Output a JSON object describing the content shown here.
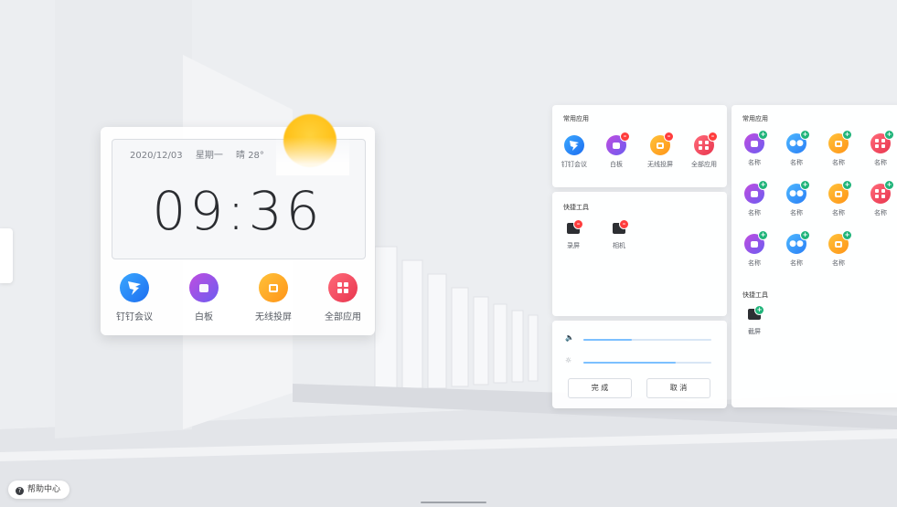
{
  "widget": {
    "date": "2020/12/03",
    "weekday": "星期一",
    "weather": "晴 28°",
    "time": "09:36",
    "apps": [
      {
        "label": "钉钉会议",
        "icon": "dingtalk-icon"
      },
      {
        "label": "白板",
        "icon": "whiteboard-icon"
      },
      {
        "label": "无线投屏",
        "icon": "screencast-icon"
      },
      {
        "label": "全部应用",
        "icon": "all-apps-icon"
      }
    ]
  },
  "common_apps_panel": {
    "title": "常用应用",
    "apps": [
      {
        "label": "钉钉会议",
        "icon": "dingtalk-icon"
      },
      {
        "label": "白板",
        "icon": "whiteboard-icon"
      },
      {
        "label": "无线投屏",
        "icon": "screencast-icon"
      },
      {
        "label": "全部应用",
        "icon": "all-apps-icon"
      }
    ]
  },
  "quick_tools_panel": {
    "title": "快捷工具",
    "tools": [
      {
        "label": "录屏",
        "icon": "screen-record-icon"
      },
      {
        "label": "相机",
        "icon": "camera-icon"
      }
    ]
  },
  "controls_panel": {
    "volume_level": 0.38,
    "brightness_level": 0.72,
    "confirm_label": "完 成",
    "cancel_label": "取 消"
  },
  "all_apps_panel": {
    "title": "常用应用",
    "apps": [
      {
        "label": "名称",
        "icon": "whiteboard-icon"
      },
      {
        "label": "名称",
        "icon": "people-icon"
      },
      {
        "label": "名称",
        "icon": "screencast-icon"
      },
      {
        "label": "名称",
        "icon": "all-apps-icon"
      },
      {
        "label": "名称",
        "icon": "whiteboard-icon"
      },
      {
        "label": "名称",
        "icon": "people-icon"
      },
      {
        "label": "名称",
        "icon": "screencast-icon"
      },
      {
        "label": "名称",
        "icon": "all-apps-icon"
      },
      {
        "label": "名称",
        "icon": "whiteboard-icon"
      },
      {
        "label": "名称",
        "icon": "people-icon"
      },
      {
        "label": "名称",
        "icon": "screencast-icon"
      }
    ],
    "tools_title": "快捷工具",
    "tools": [
      {
        "label": "截屏",
        "icon": "screenshot-icon"
      }
    ]
  },
  "footer": {
    "help_label": "帮助中心"
  },
  "colors": {
    "accent_blue": "#1d6df0",
    "badge_remove": "#ff3d3d",
    "badge_add": "#20b47a",
    "sun": "#ffbe12"
  }
}
